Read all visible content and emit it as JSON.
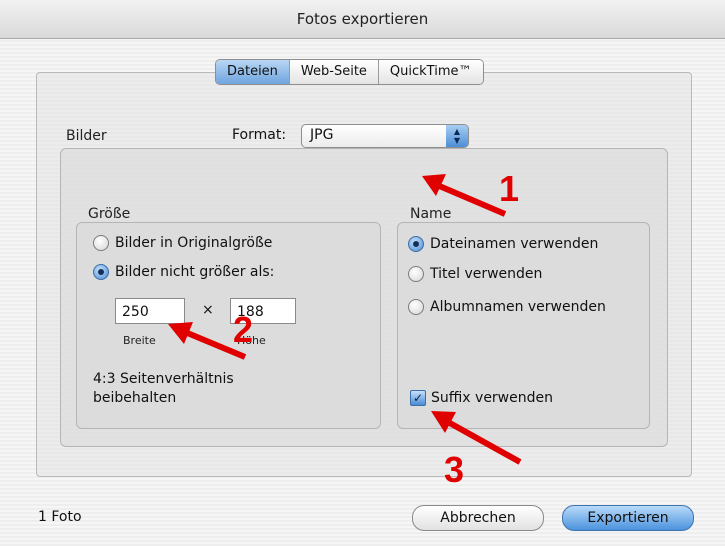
{
  "window": {
    "title": "Fotos exportieren"
  },
  "tabs": [
    {
      "label": "Dateien",
      "active": true
    },
    {
      "label": "Web-Seite",
      "active": false
    },
    {
      "label": "QuickTime™",
      "active": false
    }
  ],
  "images_group": {
    "title": "Bilder"
  },
  "format": {
    "label": "Format:",
    "value": "JPG",
    "icon": "updown-arrows-icon"
  },
  "size_group": {
    "title": "Größe",
    "options": [
      {
        "label": "Bilder in Originalgröße",
        "selected": false
      },
      {
        "label": "Bilder nicht größer als:",
        "selected": true
      }
    ],
    "width": {
      "value": "250",
      "caption": "Breite"
    },
    "times": "×",
    "height": {
      "value": "188",
      "caption": "Höhe"
    },
    "aspect_note_line1": "4:3 Seitenverhältnis",
    "aspect_note_line2": "beibehalten"
  },
  "name_group": {
    "title": "Name",
    "options": [
      {
        "label": "Dateinamen verwenden",
        "selected": true
      },
      {
        "label": "Titel verwenden",
        "selected": false
      },
      {
        "label": "Albumnamen verwenden",
        "selected": false
      }
    ],
    "suffix": {
      "label": "Suffix verwenden",
      "checked": true
    }
  },
  "footer": {
    "count": "1 Foto",
    "cancel_label": "Abbrechen",
    "export_label": "Exportieren"
  },
  "annotations": {
    "markers": [
      "1",
      "2",
      "3"
    ],
    "color": "#e00000"
  }
}
